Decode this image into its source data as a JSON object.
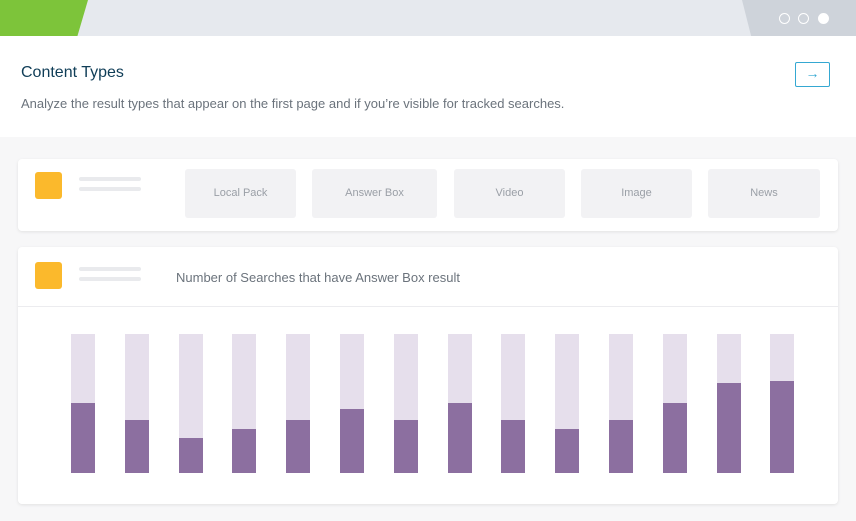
{
  "header": {
    "title": "Content Types",
    "subtitle": "Analyze the result types that appear on the first page and if you’re visible for tracked searches.",
    "arrow_icon": "→"
  },
  "colors": {
    "accent_green": "#7dc43a",
    "swatch_orange": "#fbb92c",
    "bar_fill": "#8c6fa0",
    "bar_track": "#e6dfec",
    "link_blue": "#35a8d2"
  },
  "filters": [
    "Local Pack",
    "Answer Box",
    "Video",
    "Image",
    "News"
  ],
  "chart_data": {
    "type": "bar",
    "title": "Number of Searches that have Answer Box result",
    "xlabel": "",
    "ylabel": "",
    "ylim": [
      0,
      1
    ],
    "values": [
      0.5,
      0.38,
      0.25,
      0.32,
      0.38,
      0.46,
      0.38,
      0.5,
      0.38,
      0.32,
      0.38,
      0.5,
      0.65,
      0.66
    ]
  }
}
